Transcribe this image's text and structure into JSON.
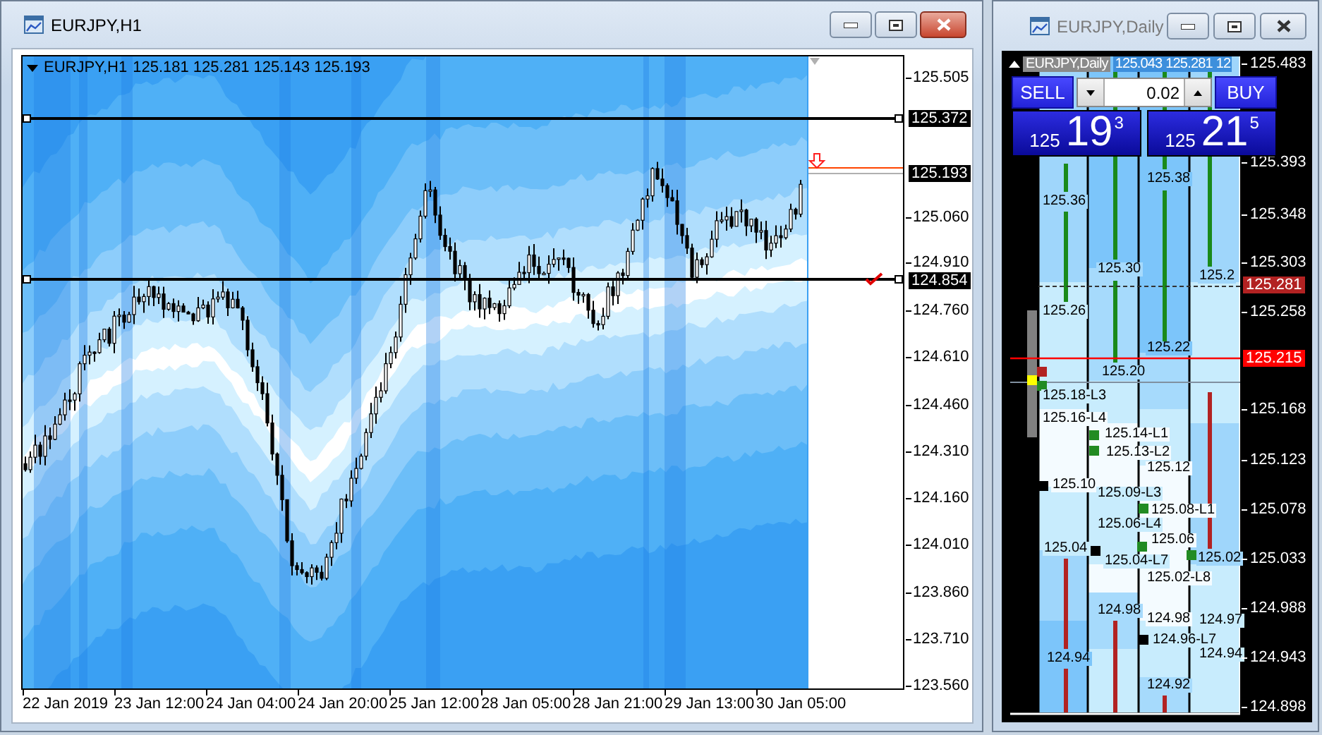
{
  "windows": [
    {
      "kind": "candles",
      "title": "EURJPY,H1",
      "active": true,
      "chart": {
        "symbol": "EURJPY,H1",
        "quote": "125.181 125.281 125.143 125.193",
        "price_ticks": [
          "125.505",
          "125.060",
          "124.910",
          "124.760",
          "124.610",
          "124.460",
          "124.310",
          "124.160",
          "124.010",
          "123.860",
          "123.710",
          "123.560"
        ],
        "price_tags": [
          {
            "text": "125.372",
            "color": "#000000"
          },
          {
            "text": "125.193",
            "color": "#000000"
          },
          {
            "text": "124.854",
            "color": "#000000"
          }
        ],
        "time_labels": [
          "22 Jan 2019",
          "23 Jan 12:00",
          "24 Jan 04:00",
          "24 Jan 20:00",
          "25 Jan 12:00",
          "28 Jan 05:00",
          "28 Jan 21:00",
          "29 Jan 13:00",
          "30 Jan 05:00"
        ]
      }
    },
    {
      "kind": "profile",
      "title": "EURJPY,Daily",
      "active": false,
      "chart": {
        "symbol": "EURJPY,Daily",
        "quote": "125.043 125.281 12",
        "trade_panel": {
          "sell_label": "SELL",
          "buy_label": "BUY",
          "volume": "0.02",
          "sell_price": {
            "big": "125",
            "main": "19",
            "sup": "3"
          },
          "buy_price": {
            "big": "125",
            "main": "21",
            "sup": "5"
          }
        },
        "price_ticks": [
          "125.483",
          "125.393",
          "125.348",
          "125.303",
          "125.258",
          "125.168",
          "125.123",
          "125.078",
          "125.033",
          "124.988",
          "124.943",
          "124.898"
        ],
        "price_tags": [
          {
            "text": "125.281",
            "color": "#b22222"
          },
          {
            "text": "125.215",
            "color": "#ff0000"
          }
        ],
        "columns": [
          {
            "labels": [
              "125.36",
              "125.26",
              "125.18-L3",
              "125.16-L4",
              "125.10",
              "125.04",
              "124.94"
            ]
          },
          {
            "labels": [
              "125.30",
              "125.20",
              "125.14-L1",
              "125.13-L2",
              "125.09-L3",
              "125.06-L4",
              "125.04-L7",
              "124.98"
            ]
          },
          {
            "labels": [
              "125.38",
              "125.22",
              "125.12",
              "125.08-L1",
              "125.06",
              "125.02-L8",
              "124.98",
              "124.96-L7",
              "124.92"
            ]
          },
          {
            "labels": [
              "125.2",
              "125.02",
              "124.97",
              "124.94"
            ]
          }
        ],
        "markers": [
          {
            "color": "#b22222"
          },
          {
            "color": "#ffff00"
          },
          {
            "color": "#228b22"
          },
          {
            "color": "#000000"
          },
          {
            "color": "#228b22"
          },
          {
            "color": "#228b22"
          },
          {
            "color": "#000000"
          },
          {
            "color": "#228b22"
          },
          {
            "color": "#228b22"
          },
          {
            "color": "#000000"
          },
          {
            "color": "#228b22"
          }
        ]
      }
    }
  ]
}
